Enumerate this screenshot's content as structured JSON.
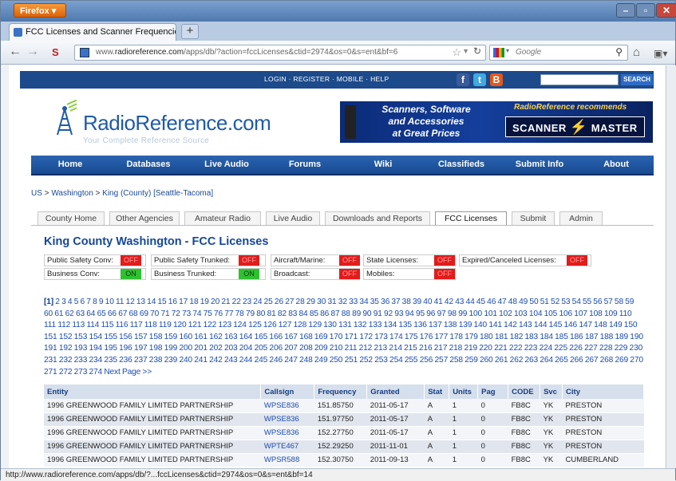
{
  "browser": {
    "app_button": "Firefox",
    "tab_title": "FCC Licenses and Scanner Frequencies f...",
    "new_tab": "+",
    "url_prefix": "www.",
    "url_domain": "radioreference.com",
    "url_path": "/apps/db/?action=fccLicenses&ctid=2974&os=0&s=ent&bf=6",
    "search_placeholder": "Google",
    "status_text": "http://www.radioreference.com/apps/db/?...fccLicenses&ctid=2974&os=0&s=ent&bf=14"
  },
  "site": {
    "top_links": "LOGIN · REGISTER · MOBILE · HELP",
    "search_button": "SEARCH",
    "logo_text": "RadioReference.com",
    "logo_tagline": "Your Complete Reference Source",
    "banner": {
      "line1": "Scanners, Software",
      "line2": "and Accessories",
      "line3": "at Great Prices",
      "recommends": "RadioReference recommends",
      "scanner": "SCANNER",
      "master": "MASTER"
    },
    "nav": [
      "Home",
      "Databases",
      "Live Audio",
      "Forums",
      "Wiki",
      "Classifieds",
      "Submit Info",
      "About"
    ]
  },
  "breadcrumb": {
    "us": "US",
    "sep": " > ",
    "state": "Washington",
    "county": "King (County) [Seattle-Tacoma]"
  },
  "subtabs": [
    "County Home",
    "Other Agencies",
    "Amateur Radio",
    "Live Audio",
    "Downloads and Reports",
    "FCC Licenses",
    "Submit",
    "Admin"
  ],
  "page_title": "King County Washington - FCC Licenses",
  "filters": {
    "public_safety_conv": {
      "label": "Public Safety Conv:",
      "state": "OFF"
    },
    "public_safety_trunked": {
      "label": "Public Safety Trunked:",
      "state": "OFF"
    },
    "aircraft_marine": {
      "label": "Aircraft/Marine:",
      "state": "OFF"
    },
    "state_licenses": {
      "label": "State Licenses:",
      "state": "OFF"
    },
    "expired": {
      "label": "Expired/Canceled Licenses:",
      "state": "OFF"
    },
    "business_conv": {
      "label": "Business Conv:",
      "state": "ON"
    },
    "business_trunked": {
      "label": "Business Trunked:",
      "state": "ON"
    },
    "broadcast": {
      "label": "Broadcast:",
      "state": "OFF"
    },
    "mobiles": {
      "label": "Mobiles:",
      "state": "OFF"
    }
  },
  "pagination": {
    "current": "[1]",
    "last": 274,
    "next": "Next Page >>"
  },
  "table": {
    "headers": [
      "Entity",
      "Callsign",
      "Frequency",
      "Granted",
      "Stat",
      "Units",
      "Pag",
      "CODE",
      "Svc",
      "City"
    ],
    "rows": [
      [
        "1996 GREENWOOD FAMILY LIMITED PARTNERSHIP",
        "WPSE836",
        "151.85750",
        "2011-05-17",
        "A",
        "1",
        "0",
        "FB8C",
        "YK",
        "PRESTON"
      ],
      [
        "1996 GREENWOOD FAMILY LIMITED PARTNERSHIP",
        "WPSE836",
        "151.97750",
        "2011-05-17",
        "A",
        "1",
        "0",
        "FB8C",
        "YK",
        "PRESTON"
      ],
      [
        "1996 GREENWOOD FAMILY LIMITED PARTNERSHIP",
        "WPSE836",
        "152.27750",
        "2011-05-17",
        "A",
        "1",
        "0",
        "FB8C",
        "YK",
        "PRESTON"
      ],
      [
        "1996 GREENWOOD FAMILY LIMITED PARTNERSHIP",
        "WPTE467",
        "152.29250",
        "2011-11-01",
        "A",
        "1",
        "0",
        "FB8C",
        "YK",
        "PRESTON"
      ],
      [
        "1996 GREENWOOD FAMILY LIMITED PARTNERSHIP",
        "WPSR588",
        "152.30750",
        "2011-09-13",
        "A",
        "1",
        "0",
        "FB8C",
        "YK",
        "CUMBERLAND"
      ]
    ]
  },
  "colors": {
    "nav_blue": "#1c4a8a",
    "link_blue": "#1a4bb0",
    "off_red": "#e21b1b",
    "on_green": "#2fc12f",
    "header_bg": "#d6dfec"
  }
}
